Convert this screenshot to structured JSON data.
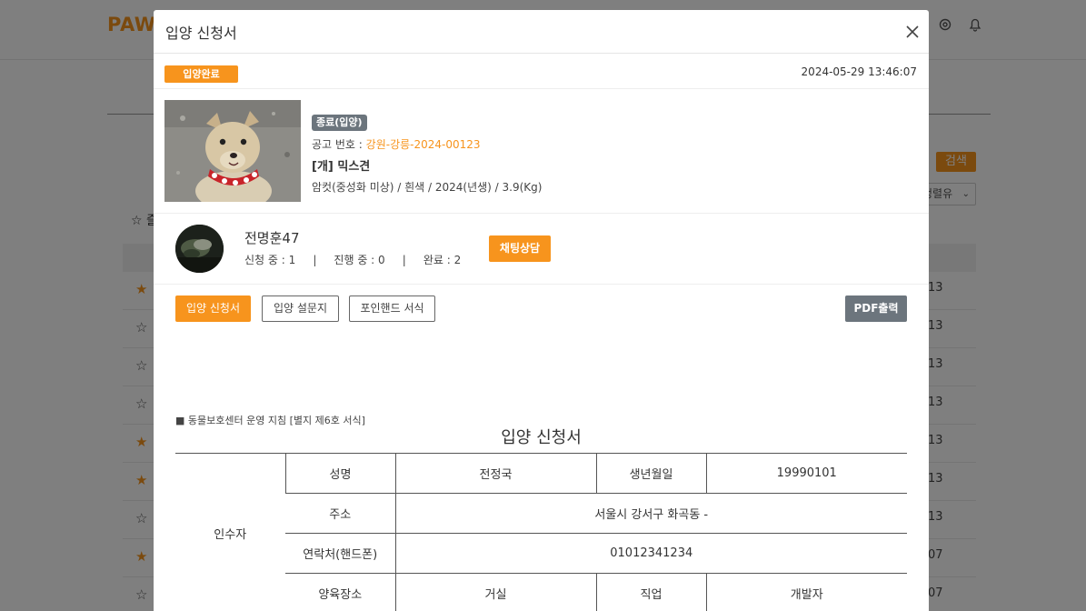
{
  "background": {
    "logo": "PAW",
    "search_label": "검색",
    "sort_select_value": "정렬유",
    "favorites_label": "즐",
    "rows": [
      {
        "fav": true,
        "tail": "13"
      },
      {
        "fav": false,
        "tail": "13"
      },
      {
        "fav": false,
        "tail": "13"
      },
      {
        "fav": false,
        "tail": "13"
      },
      {
        "fav": true,
        "tail": "13"
      },
      {
        "fav": true,
        "tail": "13"
      },
      {
        "fav": false,
        "tail": "13"
      },
      {
        "fav": true,
        "tail": "07"
      },
      {
        "fav": false,
        "tail": "07"
      }
    ]
  },
  "modal": {
    "title": "입양 신청서",
    "close_icon": "close-icon",
    "status_badge": "입양완료",
    "datetime": "2024-05-29 13:46:07",
    "animal": {
      "end_badge": "종료(입양)",
      "notice_label": "공고 번호 : ",
      "notice_number": "강원-강릉-2024-00123",
      "breed": "[개] 믹스견",
      "details": "암컷(중성화 미상) / 흰색 / 2024(년생) / 3.9(Kg)"
    },
    "applicant": {
      "name": "전명훈47",
      "stats": "신청 중 : 1     |     진행 중 : 0     |     완료 : 2",
      "chat_button": "채팅상담"
    },
    "tabs": [
      {
        "label": "입양 신청서",
        "active": true
      },
      {
        "label": "입양 설문지",
        "active": false
      },
      {
        "label": "포인핸드 서식",
        "active": false
      }
    ],
    "pdf_button": "PDF출력",
    "guide_note": "■ 동물보호센터 운영 지침 [별지 제6호 서식]",
    "form": {
      "title": "입양 신청서",
      "group_label": "인수자",
      "name_label": "성명",
      "name_value": "전정국",
      "birth_label": "생년월일",
      "birth_value": "19990101",
      "address_label": "주소",
      "address_value": "서울시 강서구 화곡동 -",
      "phone_label": "연락처(핸드폰)",
      "phone_value": "01012341234",
      "place_label": "양육장소",
      "place_value": "거실",
      "job_label": "직업",
      "job_value": "개발자"
    }
  },
  "colors": {
    "accent": "#f7941d",
    "gray_badge": "#6c757d"
  }
}
